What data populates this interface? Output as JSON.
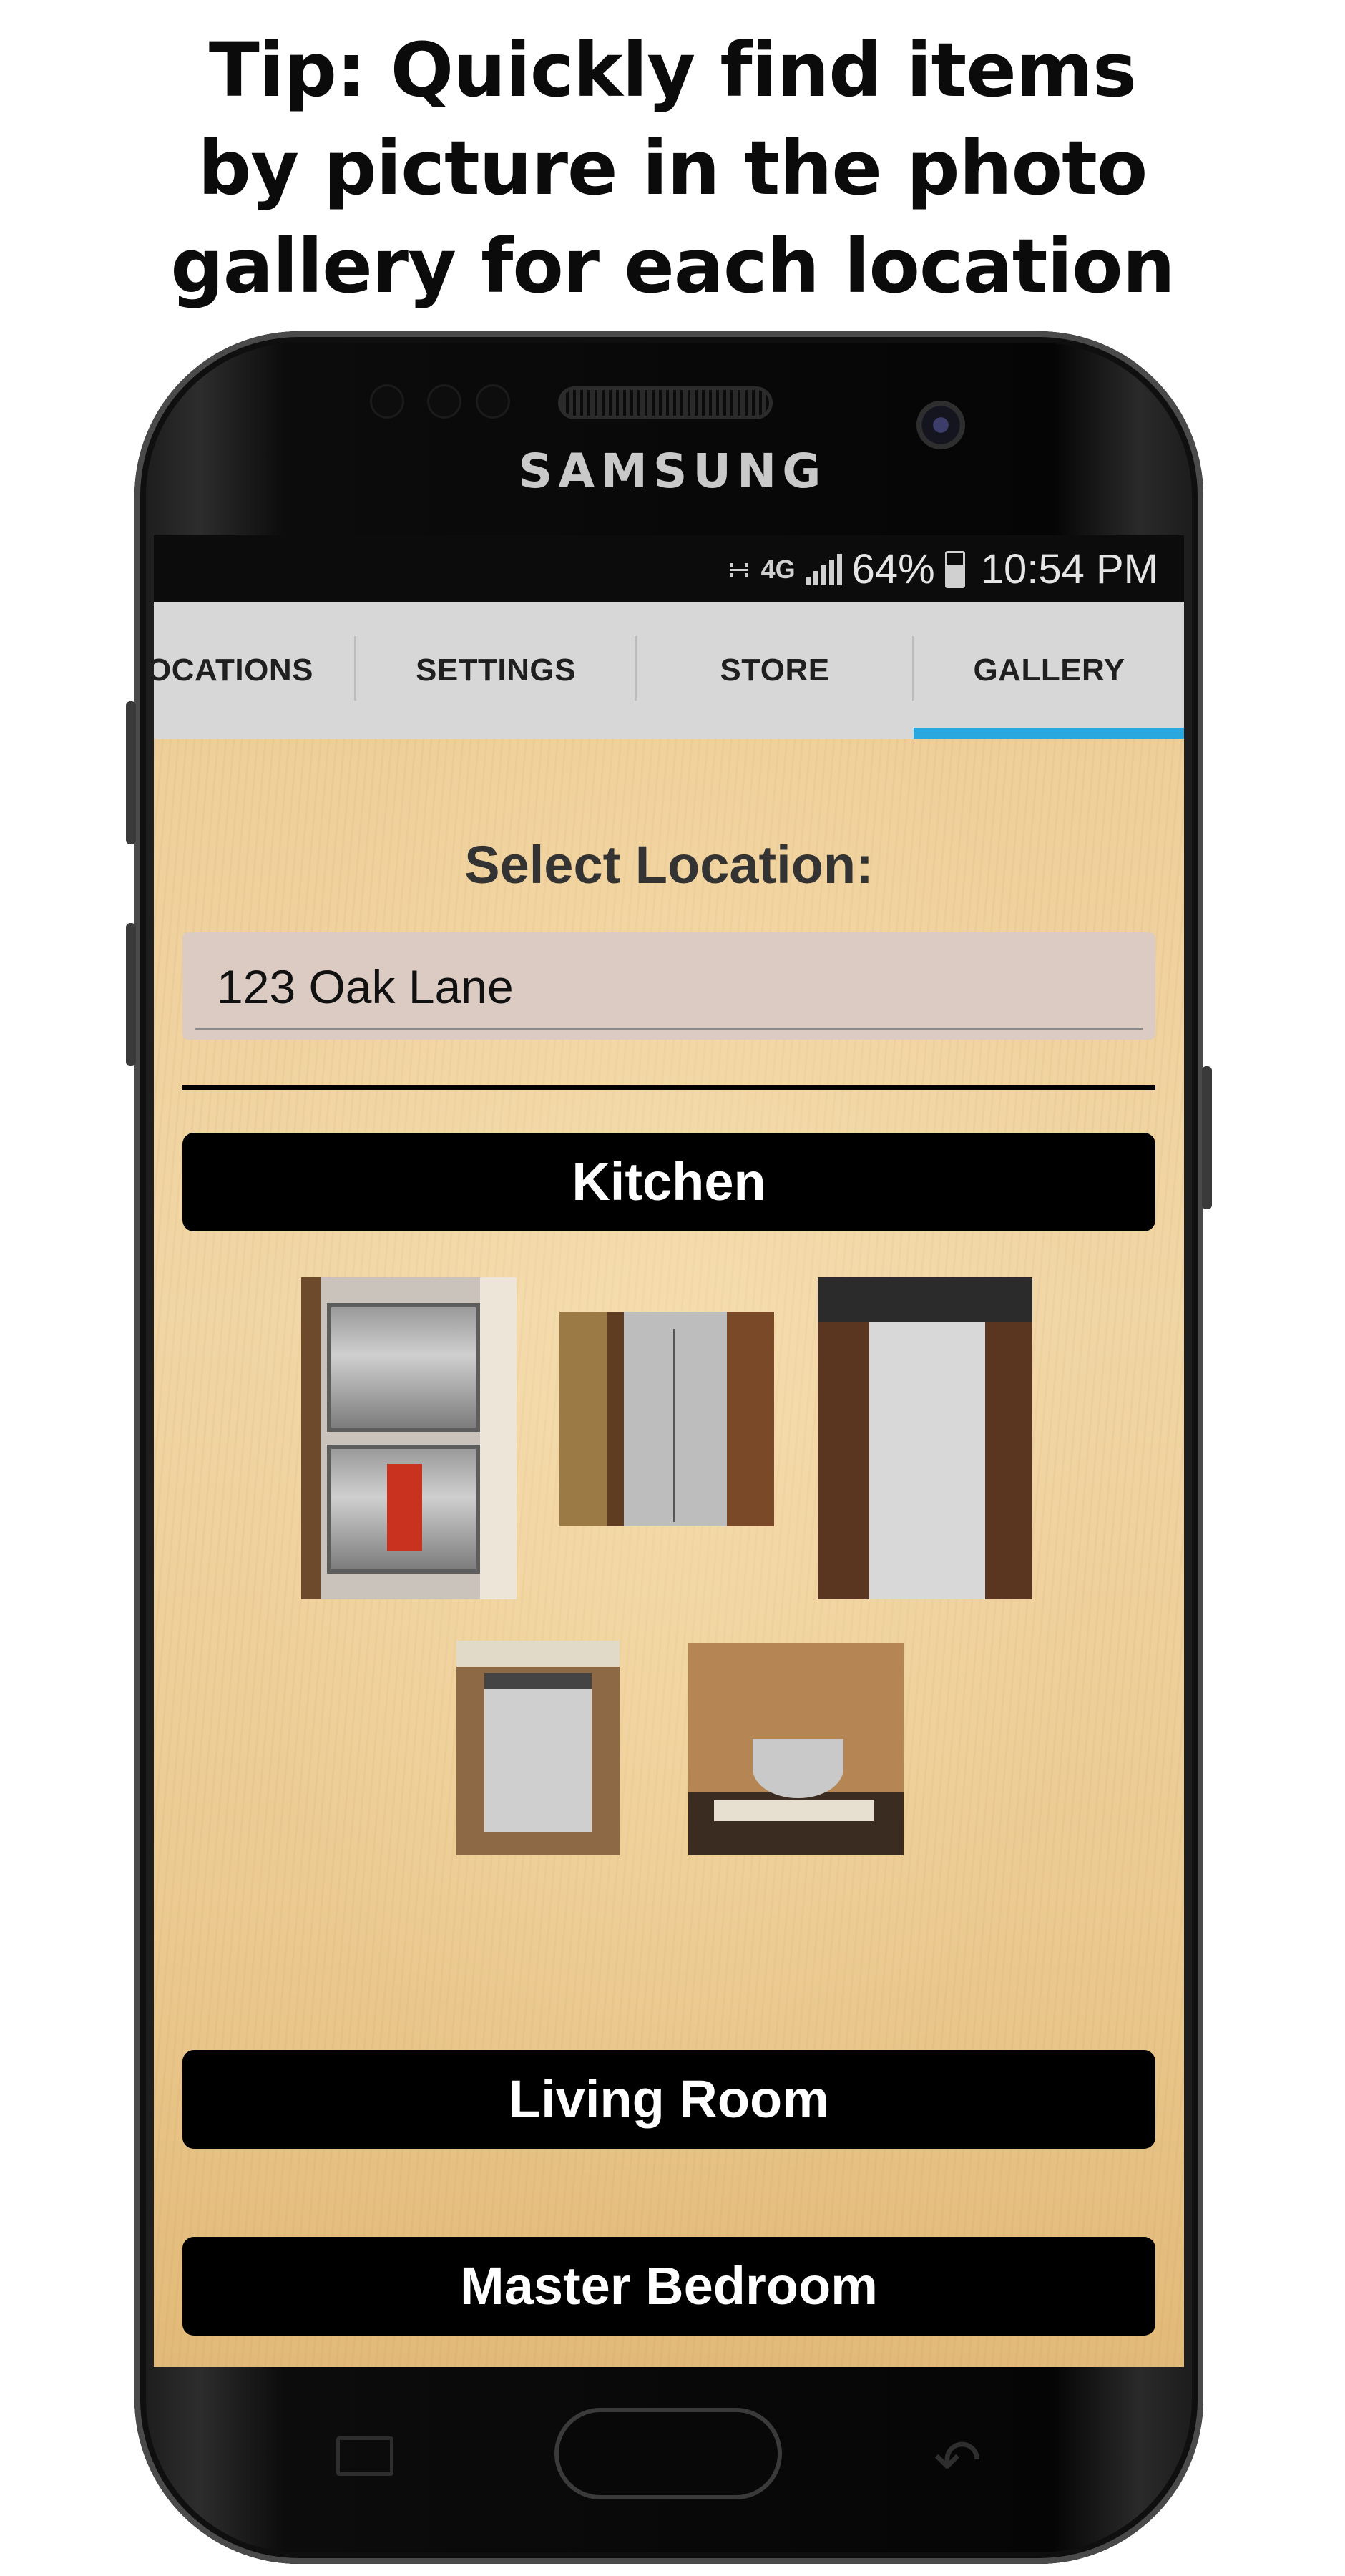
{
  "promo": {
    "headline_lines": [
      "Tip: Quickly find items",
      "by picture in the photo",
      "gallery for each location"
    ]
  },
  "device": {
    "brand": "SAMSUNG"
  },
  "status_bar": {
    "network": "4G",
    "battery": "64%",
    "time": "10:54 PM",
    "icons": [
      "wifi-icon",
      "signal-icon",
      "battery-icon"
    ]
  },
  "tabs": {
    "items": [
      {
        "label": "OCATIONS"
      },
      {
        "label": "SETTINGS"
      },
      {
        "label": "STORE"
      },
      {
        "label": "GALLERY"
      }
    ],
    "active": "GALLERY",
    "accent_color": "#28a8df"
  },
  "gallery": {
    "select_label": "Select Location:",
    "selected_location": "123 Oak Lane",
    "sections": [
      {
        "name": "Kitchen",
        "photos": [
          "wall oven",
          "refrigerator",
          "dishwasher",
          "dishwasher",
          "stand mixer"
        ]
      },
      {
        "name": "Living Room"
      },
      {
        "name": "Master Bedroom"
      }
    ]
  }
}
